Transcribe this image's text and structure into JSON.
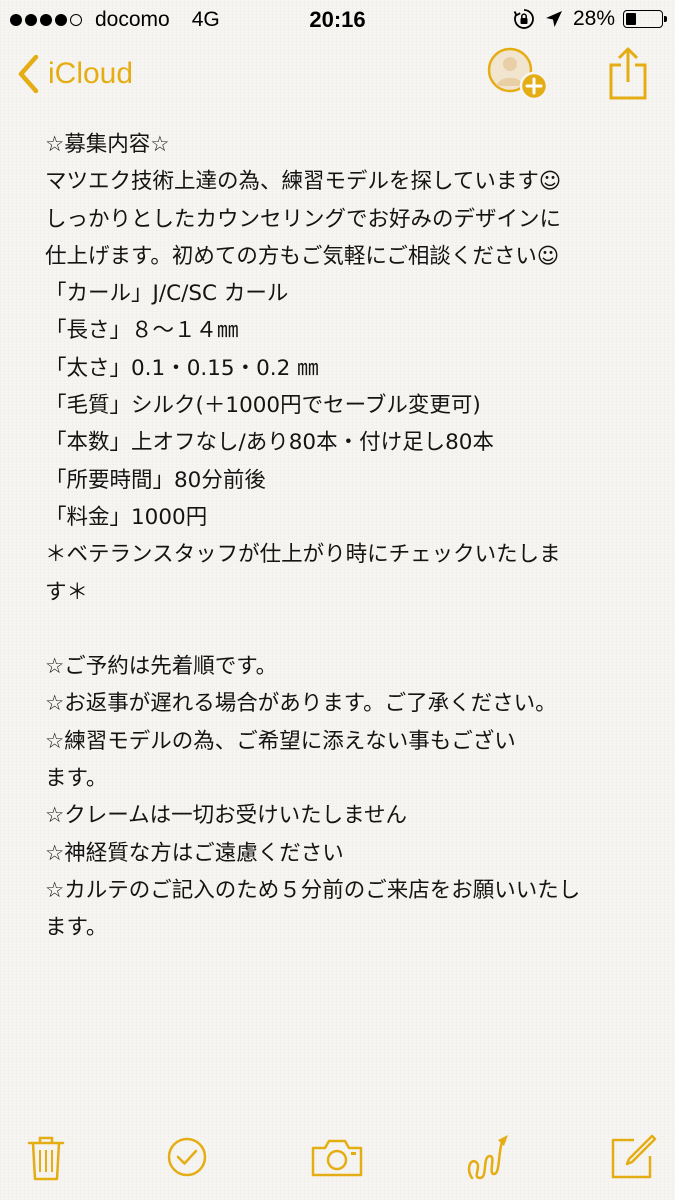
{
  "status_bar": {
    "carrier": "docomo",
    "network": "4G",
    "time": "20:16",
    "battery_percent": "28%",
    "battery_level": 0.28,
    "signal_bars": 4,
    "signal_total": 5
  },
  "nav": {
    "back_label": "iCloud",
    "back_icon": "chevron-left-icon",
    "add_person_icon": "add-person-icon",
    "share_icon": "share-icon"
  },
  "note": {
    "lines": [
      "☆募集内容☆",
      "マツエク技術上達の為、練習モデルを探しています☺",
      "しっかりとしたカウンセリングでお好みのデザインに",
      "仕上げます。初めての方もご気軽にご相談ください☺",
      "「カール」J/C/SC カール",
      "「長さ」８〜１４㎜",
      "「太さ」0.1・0.15・0.2 ㎜",
      "「毛質」シルク(＋1000円でセーブル変更可)",
      "「本数」上オフなし/あり80本・付け足し80本",
      "「所要時間」80分前後",
      "「料金」1000円",
      "＊ベテランスタッフが仕上がり時にチェックいたしま",
      "す＊",
      "",
      "☆ご予約は先着順です。",
      "☆お返事が遅れる場合があります。ご了承ください。",
      "☆練習モデルの為、ご希望に添えない事もござい",
      "ます。",
      "☆クレームは一切お受けいたしません",
      "☆神経質な方はご遠慮ください",
      "☆カルテのご記入のため５分前のご来店をお願いいたし",
      "ます。"
    ]
  },
  "toolbar": {
    "icons": [
      "trash-icon",
      "checklist-icon",
      "camera-icon",
      "sketch-icon",
      "compose-icon"
    ]
  },
  "colors": {
    "accent": "#e5ad14",
    "background": "#f7f5f1",
    "text": "#141414"
  }
}
